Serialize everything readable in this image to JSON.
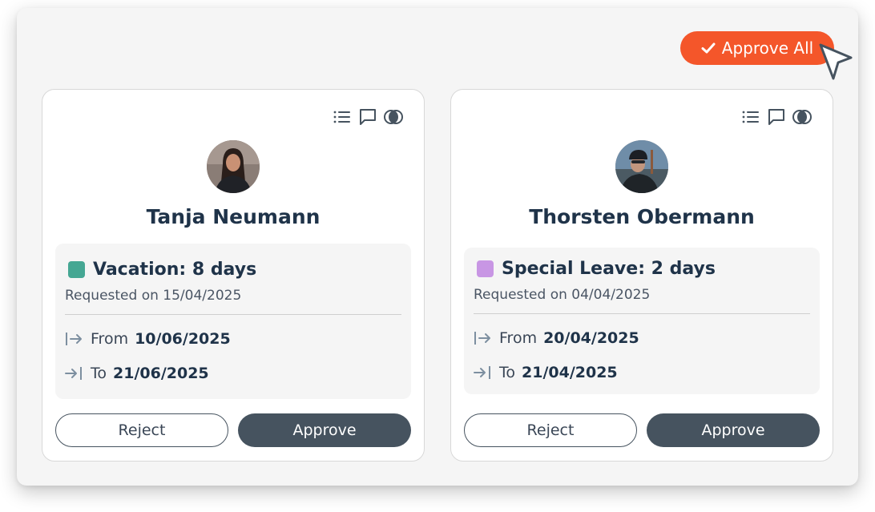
{
  "toolbar": {
    "approve_all_label": "Approve All",
    "approve_all_icon": "check-icon",
    "accent": "#f4562a"
  },
  "cards": [
    {
      "name": "Tanja Neumann",
      "leave_type": "Vacation: 8 days",
      "leave_color": "#45a793",
      "requested": "Requested on 15/04/2025",
      "from_label": "From",
      "from_date": "10/06/2025",
      "to_label": "To",
      "to_date": "21/06/2025",
      "reject_label": "Reject",
      "approve_label": "Approve",
      "icons": [
        "list-icon",
        "comment-icon",
        "contrast-icon"
      ]
    },
    {
      "name": "Thorsten Obermann",
      "leave_type": "Special Leave: 2 days",
      "leave_color": "#c896e4",
      "requested": "Requested on 04/04/2025",
      "from_label": "From",
      "from_date": "20/04/2025",
      "to_label": "To",
      "to_date": "21/04/2025",
      "reject_label": "Reject",
      "approve_label": "Approve",
      "icons": [
        "list-icon",
        "comment-icon",
        "contrast-icon"
      ]
    }
  ],
  "colors": {
    "primary_button": "#46535f",
    "text": "#1f3349"
  }
}
